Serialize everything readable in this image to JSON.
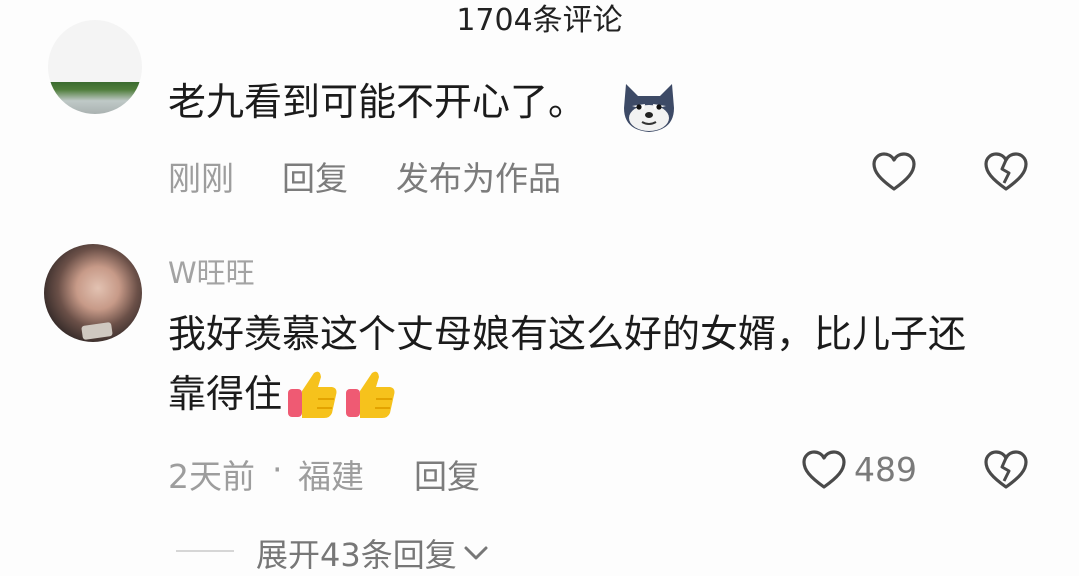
{
  "header": {
    "comment_count_title": "1704条评论"
  },
  "comments": [
    {
      "text": "老九看到可能不开心了。",
      "time": "刚刚",
      "reply_label": "回复",
      "publish_label": "发布为作品",
      "emoji": "husky-dog-face-icon"
    },
    {
      "username": "W旺旺",
      "text_line1": "我好羡慕这个丈母娘有这么好的女婿，比儿子还",
      "text_line2": "靠得住",
      "emoji": "thumbs-up-icon",
      "time": "2天前",
      "separator": "·",
      "location": "福建",
      "reply_label": "回复",
      "like_count": "489"
    }
  ],
  "expand": {
    "label": "展开43条回复"
  },
  "colors": {
    "text": "#1b1b1b",
    "meta": "#9d9d9d",
    "icon_stroke": "#4a4a4a",
    "thumb": "#f6c21c",
    "cuff": "#ef5a73"
  }
}
